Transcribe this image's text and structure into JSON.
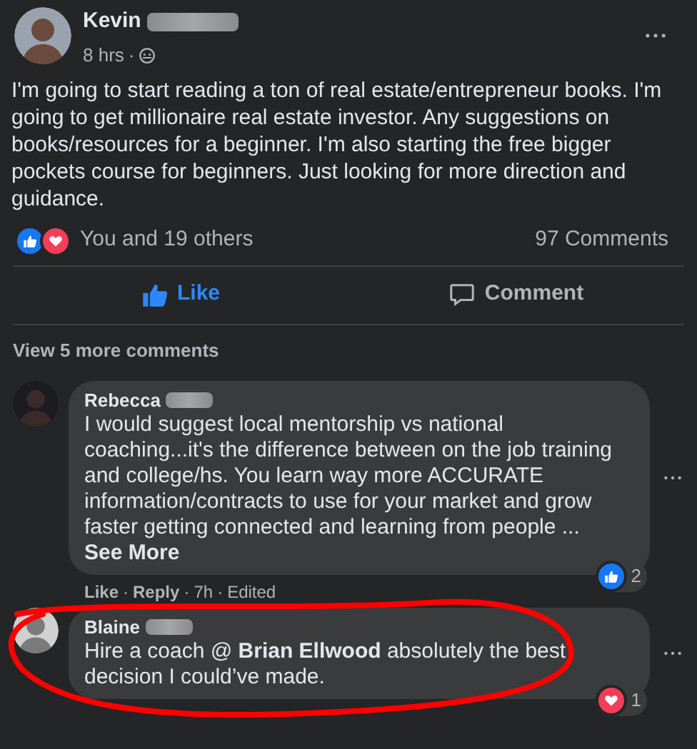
{
  "post": {
    "author": "Kevin",
    "author_redacted": true,
    "time": "8 hrs",
    "text": "I'm going to start reading a ton of real estate/entrepreneur books. I'm going to get millionaire real estate investor. Any suggestions on books/resources for a beginner. I'm also starting the free bigger pockets course for beginners. Just looking for more direction and guidance.",
    "reactions": [
      {
        "kind": "like"
      },
      {
        "kind": "love"
      }
    ],
    "reactors": "You and 19 others",
    "comments_count": "97 Comments"
  },
  "actions": [
    {
      "kind": "like",
      "label": "Like",
      "selected": true
    },
    {
      "kind": "comment",
      "label": "Comment",
      "selected": false
    }
  ],
  "separator": "·",
  "view_more": "View 5 more comments",
  "comments": [
    {
      "author": "Rebecca",
      "author_redacted": true,
      "text": "I would suggest local mentorship vs national coaching...it's the difference between on the job training and college/hs. You learn way more ACCURATE information/contracts to use for your market and grow faster getting connected and learning from people ...",
      "see_more": "See More",
      "reaction": {
        "kind": "like",
        "count": "2"
      },
      "meta": [
        {
          "kind": "link",
          "text": "Like"
        },
        {
          "kind": "link",
          "text": "Reply"
        },
        {
          "kind": "plain",
          "text": "7h"
        },
        {
          "kind": "plain",
          "text": "Edited"
        }
      ],
      "circled": false
    },
    {
      "author": "Blaine",
      "author_redacted": true,
      "text": "Hire a coach @ **Brian Ellwood** absolutely the best decision I could’ve made.",
      "reaction": {
        "kind": "love",
        "count": "1"
      },
      "circled": true
    }
  ]
}
